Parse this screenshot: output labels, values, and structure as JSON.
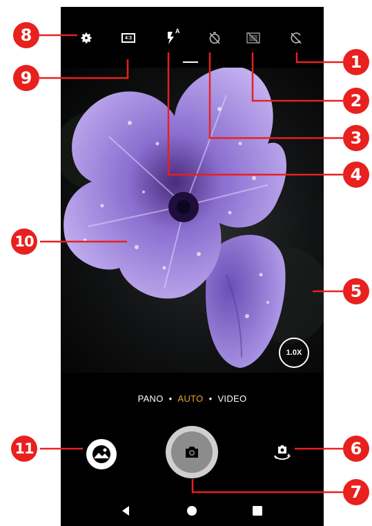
{
  "top_controls": [
    {
      "icon": "gear-icon"
    },
    {
      "icon": "aspect-ratio-icon",
      "label": "4:3"
    },
    {
      "icon": "flash-auto-icon",
      "label": "A"
    },
    {
      "icon": "timer-off-icon"
    },
    {
      "icon": "hdr-off-icon"
    },
    {
      "icon": "beauty-off-icon"
    }
  ],
  "zoom": {
    "label": "1.0X"
  },
  "modes": {
    "pano": "PANO",
    "auto": "AUTO",
    "video": "VIDEO",
    "separator": "•",
    "active_color": "#e8a92a"
  },
  "bottom_controls": {
    "gallery_icon": "gallery-icon",
    "shutter_icon": "camera-icon",
    "switch_icon": "switch-camera-icon"
  },
  "nav": [
    "back-icon",
    "home-icon",
    "recents-icon"
  ],
  "callouts": {
    "c1": "1",
    "c2": "2",
    "c3": "3",
    "c4": "4",
    "c5": "5",
    "c6": "6",
    "c7": "7",
    "c8": "8",
    "c9": "9",
    "c10": "10",
    "c11": "11"
  },
  "colors": {
    "callout": "#e8201e",
    "flower": "#a58be0",
    "background": "#000000"
  }
}
